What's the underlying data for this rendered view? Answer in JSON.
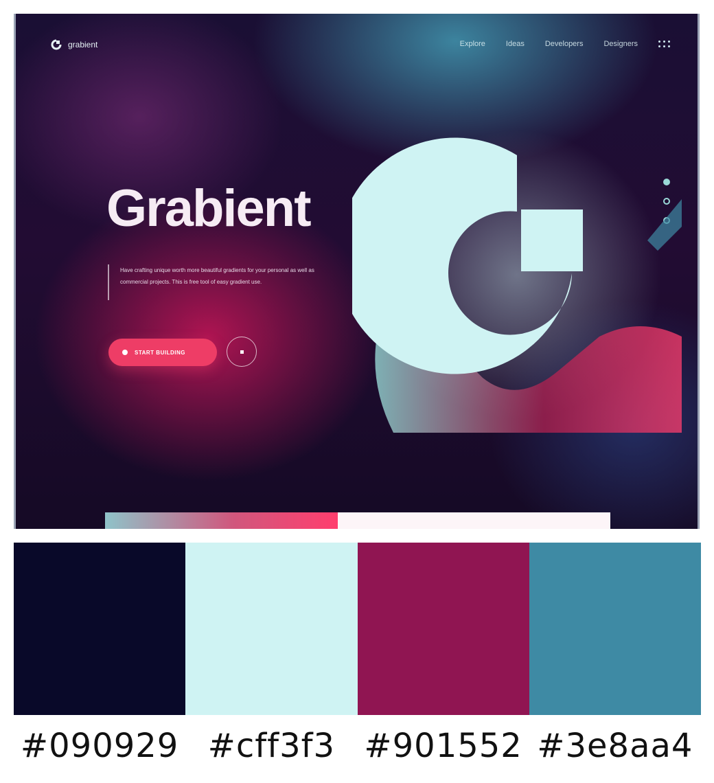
{
  "nav": {
    "brand": "grabient",
    "links": [
      "Explore",
      "Ideas",
      "Developers",
      "Designers"
    ]
  },
  "hero": {
    "title": "Grabient",
    "description": "Have crafting unique worth more beautiful gradients for your personal as well as commercial projects. This is free tool of easy gradient use.",
    "primary_button": "START BUILDING",
    "progress_fraction": 0.46
  },
  "side_nav": {
    "count": 3,
    "active_index": 0
  },
  "palette": {
    "colors": [
      "#090929",
      "#cff3f3",
      "#901552",
      "#3e8aa4"
    ],
    "labels": [
      "#090929",
      "#cff3f3",
      "#901552",
      "#3e8aa4"
    ]
  },
  "icons": {
    "logo": "grabient-logo-icon",
    "menu": "grid-menu-icon",
    "play": "play-icon"
  }
}
